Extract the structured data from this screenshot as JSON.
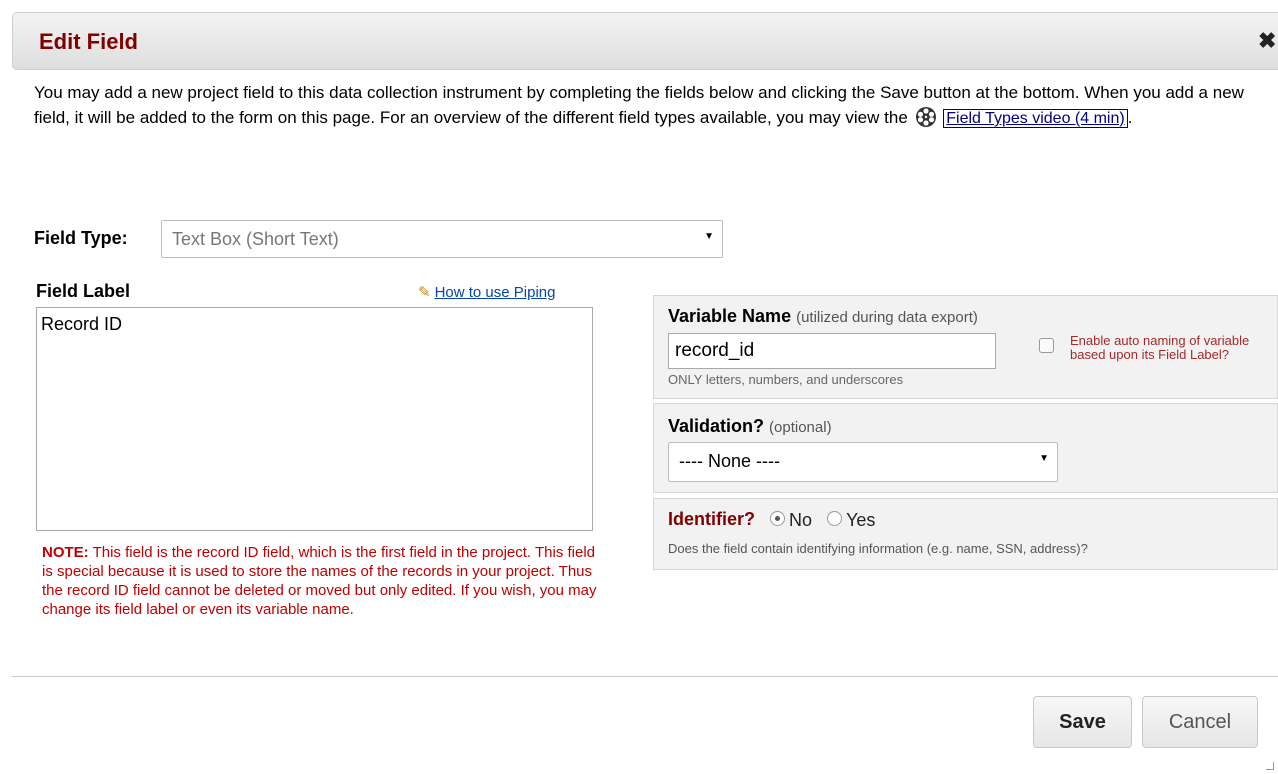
{
  "dialog": {
    "title": "Edit Field",
    "close_glyph": "✖"
  },
  "intro": {
    "text": "You may add a new project field to this data collection instrument by completing the fields below and clicking the Save button at the bottom. When you add a new field, it will be added to the form on this page. For an overview of the different field types available, you may view the",
    "video_link": "Field Types video (4 min)",
    "trailing": "."
  },
  "field_type": {
    "label": "Field Type:",
    "value": "Text Box (Short Text)"
  },
  "field_label": {
    "label": "Field Label",
    "piping_link": "How to use Piping",
    "value": "Record ID"
  },
  "note": {
    "prefix": "NOTE:",
    "text": " This field is the record ID field, which is the first field in the project. This field is special because it is used to store the names of the records in your project. Thus the record ID field cannot be deleted or moved but only edited. If you wish, you may change its field label or even its variable name."
  },
  "variable_name": {
    "label": "Variable Name",
    "sublabel": "(utilized during data export)",
    "value": "record_id",
    "hint": "ONLY letters, numbers, and underscores",
    "auto_naming_label": "Enable auto naming of variable based upon its Field Label?"
  },
  "validation": {
    "label": "Validation?",
    "sublabel": "(optional)",
    "value": "---- None ----"
  },
  "identifier": {
    "label": "Identifier?",
    "options": [
      "No",
      "Yes"
    ],
    "selected": "No",
    "hint": "Does the field contain identifying information (e.g. name, SSN, address)?"
  },
  "buttons": {
    "save": "Save",
    "cancel": "Cancel"
  },
  "colors": {
    "title": "#800000",
    "note": "#c00000",
    "link": "#0645ad"
  },
  "icons": [
    "film-reel-icon",
    "pencil-icon",
    "close-icon",
    "dropdown-arrow-icon",
    "resize-handle-icon"
  ]
}
